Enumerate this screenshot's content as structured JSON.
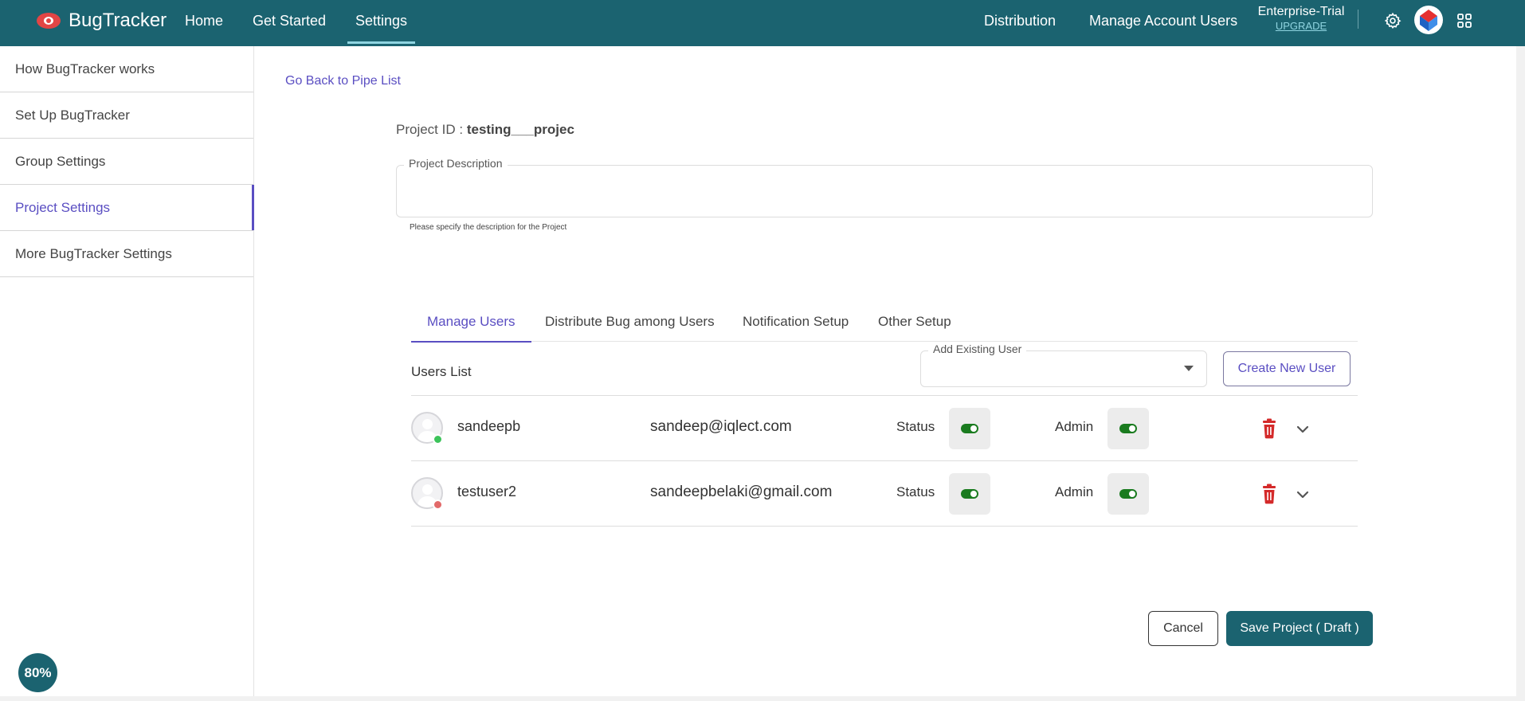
{
  "header": {
    "brand": "BugTracker",
    "nav": [
      "Home",
      "Get Started",
      "Settings"
    ],
    "right_nav": [
      "Distribution",
      "Manage Account Users"
    ],
    "plan": "Enterprise-Trial",
    "upgrade": "UPGRADE",
    "icons": [
      "gear-icon",
      "profile-avatar-icon",
      "apps-grid-icon"
    ]
  },
  "sidebar": {
    "items": [
      {
        "label": "How BugTracker works"
      },
      {
        "label": "Set Up BugTracker"
      },
      {
        "label": "Group Settings"
      },
      {
        "label": "Project Settings",
        "active": true
      },
      {
        "label": "More BugTracker Settings"
      }
    ],
    "zoom": "80%"
  },
  "main": {
    "back_link": "Go Back to Pipe List",
    "project_id_label": "Project ID :",
    "project_id_value": "testing___projec",
    "description": {
      "label": "Project Description",
      "value": "",
      "helper": "Please specify the description for the Project"
    },
    "tabs": [
      "Manage Users",
      "Distribute Bug among Users",
      "Notification Setup",
      "Other Setup"
    ],
    "active_tab": "Manage Users",
    "users_list_title": "Users List",
    "add_existing_user": {
      "label": "Add Existing User",
      "value": ""
    },
    "create_new_user": "Create New User",
    "users": [
      {
        "name": "sandeepb",
        "email": "sandeep@iqlect.com",
        "status_label": "Status",
        "status_on": true,
        "admin_label": "Admin",
        "admin_on": true,
        "presence": "online",
        "presence_color": "#3cc35a"
      },
      {
        "name": "testuser2",
        "email": "sandeepbelaki@gmail.com",
        "status_label": "Status",
        "status_on": true,
        "admin_label": "Admin",
        "admin_on": true,
        "presence": "offline",
        "presence_color": "#e26a6a"
      }
    ],
    "cancel": "Cancel",
    "save": "Save Project ( Draft )"
  },
  "colors": {
    "primary": "#1b6370",
    "accent": "#5a4ec2",
    "toggle_on": "#1a7b1f",
    "delete": "#d42a2a"
  }
}
